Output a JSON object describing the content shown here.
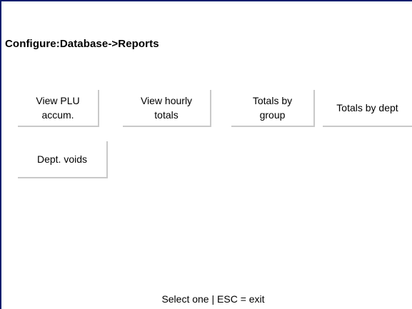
{
  "header": {
    "title": "Configure:Database->Reports"
  },
  "buttons": {
    "view_plu_accum": "View PLU\naccum.",
    "view_hourly_totals": "View hourly\ntotals",
    "totals_by_group": "Totals by\ngroup",
    "totals_by_dept": "Totals by dept",
    "dept_voids": "Dept. voids"
  },
  "footer": {
    "status": "Select one | ESC = exit"
  },
  "colors": {
    "border": "#0a1e6e",
    "button_shadow": "#c9c9c9",
    "background": "#ffffff"
  }
}
